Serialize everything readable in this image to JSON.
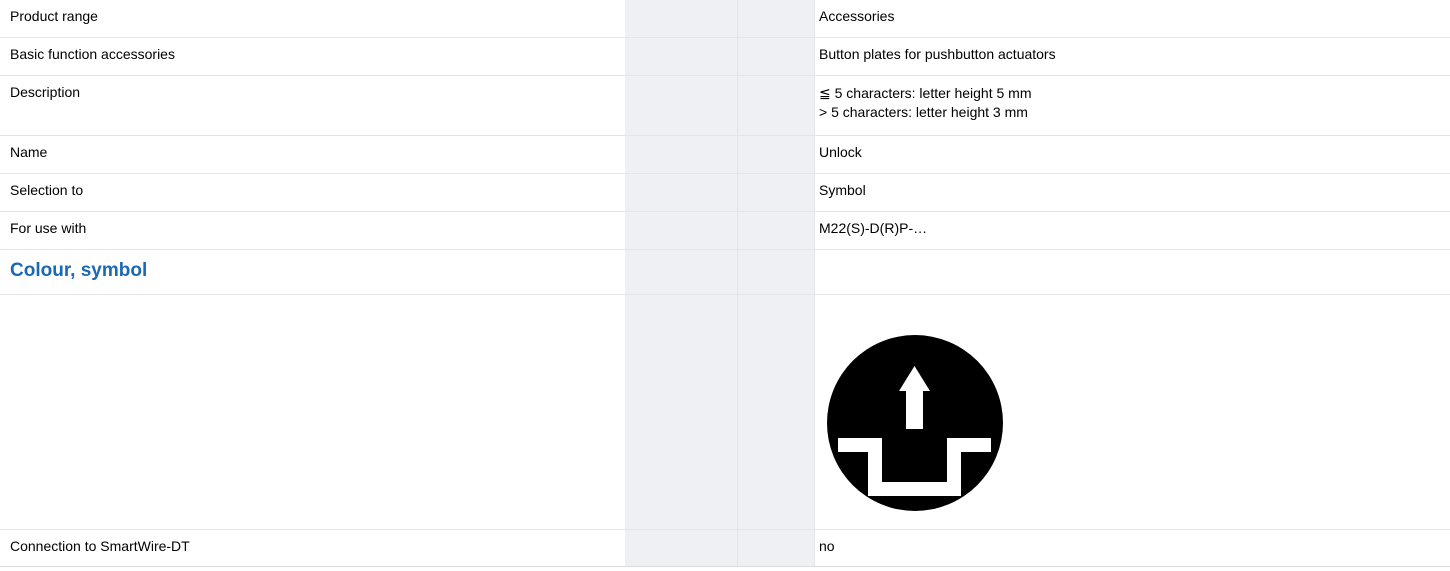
{
  "rows": {
    "product_range": {
      "label": "Product range",
      "value": "Accessories"
    },
    "basic_function": {
      "label": "Basic function accessories",
      "value": "Button plates for pushbutton actuators"
    },
    "description": {
      "label": "Description",
      "value_line1": "≦ 5 characters: letter height 5 mm",
      "value_line2": "> 5 characters: letter height 3 mm"
    },
    "name": {
      "label": "Name",
      "value": "Unlock"
    },
    "selection": {
      "label": "Selection to",
      "value": "Symbol"
    },
    "use_with": {
      "label": "For use with",
      "value": "M22(S)-D(R)P-…"
    },
    "section": {
      "title": "Colour, symbol"
    },
    "symbol": {
      "icon": "unlock-arrow-symbol-icon",
      "fill": "#000000",
      "mark": "#ffffff"
    },
    "smartwire": {
      "label": "Connection to SmartWire-DT",
      "value": "no"
    }
  }
}
